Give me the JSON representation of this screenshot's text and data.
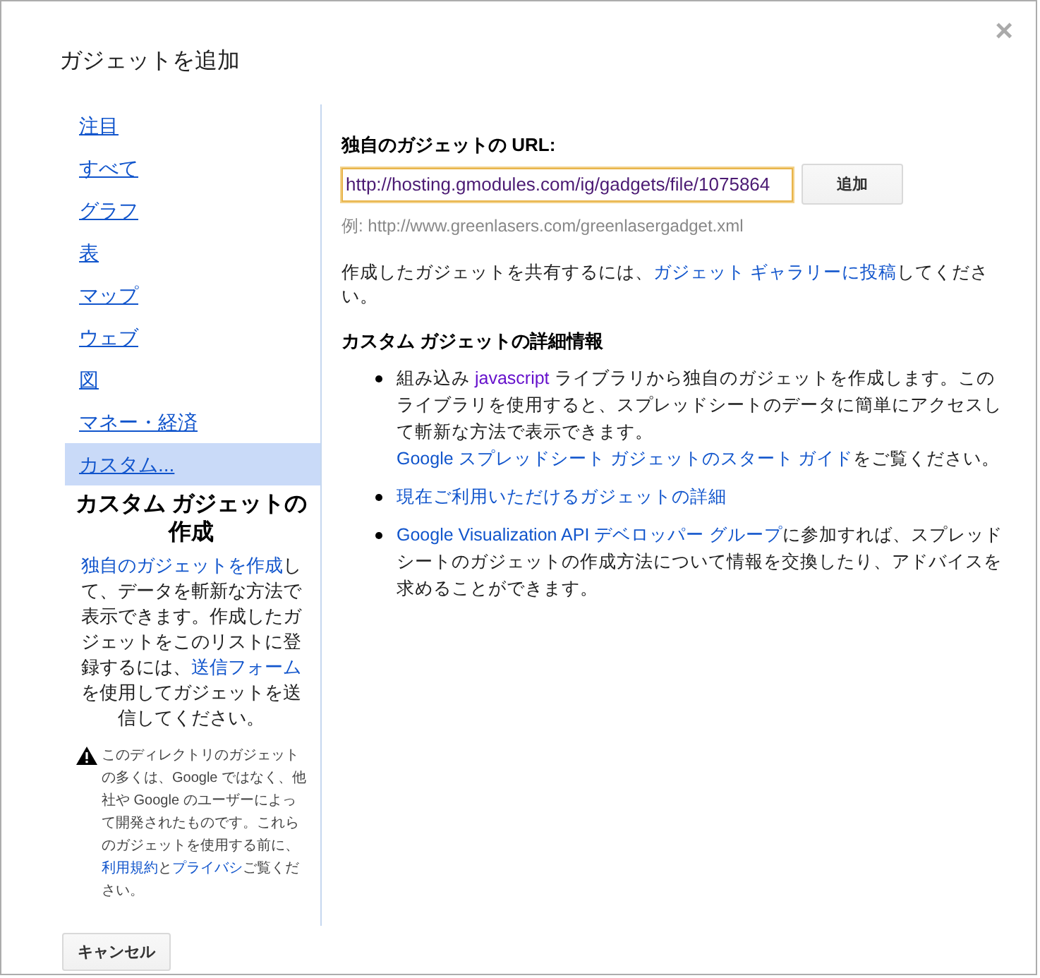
{
  "dialog": {
    "title": "ガジェットを追加",
    "close": "×"
  },
  "sidebar": {
    "items": [
      {
        "label": "注目",
        "selected": false
      },
      {
        "label": "すべて",
        "selected": false
      },
      {
        "label": "グラフ",
        "selected": false
      },
      {
        "label": "表",
        "selected": false
      },
      {
        "label": "マップ",
        "selected": false
      },
      {
        "label": "ウェブ",
        "selected": false
      },
      {
        "label": "図",
        "selected": false
      },
      {
        "label": "マネー・経済",
        "selected": false
      },
      {
        "label": "カスタム...",
        "selected": true
      }
    ],
    "custom_info": {
      "heading": "カスタム ガジェットの作成",
      "description": [
        {
          "kind": "link",
          "text": "独自のガジェットを作成"
        },
        {
          "kind": "text",
          "text": "して、データを斬新な方法で表示できます。作成したガジェットをこのリストに登録するには、"
        },
        {
          "kind": "link",
          "text": "送信フォーム"
        },
        {
          "kind": "text",
          "text": "を使用してガジェットを送信してください。"
        }
      ],
      "warning": [
        {
          "kind": "text",
          "text": "このディレクトリのガジェットの多くは、Google ではなく、他社や Google のユーザーによって開発されたものです。これらのガジェットを使用する前に、"
        },
        {
          "kind": "link",
          "text": "利用規約"
        },
        {
          "kind": "text",
          "text": "と"
        },
        {
          "kind": "link",
          "text": "プライバシ"
        },
        {
          "kind": "text",
          "text": "ご覧ください。"
        }
      ]
    }
  },
  "url_section": {
    "label": "独自のガジェットの URL:",
    "value": "http://hosting.gmodules.com/ig/gadgets/file/1075864",
    "add_button": "追加",
    "example": "例: http://www.greenlasers.com/greenlasergadget.xml"
  },
  "share_note": [
    {
      "kind": "text",
      "text": "作成したガジェットを共有するには、"
    },
    {
      "kind": "link",
      "text": "ガジェット ギャラリーに投稿"
    },
    {
      "kind": "text",
      "text": "してください。"
    }
  ],
  "details": {
    "heading": "カスタム ガジェットの詳細情報",
    "bullets": [
      [
        {
          "kind": "text",
          "text": "組み込み "
        },
        {
          "kind": "visited-link",
          "text": "javascript"
        },
        {
          "kind": "text",
          "text": " ライブラリから独自のガジェットを作成します。このライブラリを使用すると、スプレッドシートのデータに簡単にアクセスして斬新な方法で表示できます。"
        },
        {
          "kind": "link",
          "text": "Google スプレッドシート ガジェットのスタート ガイド"
        },
        {
          "kind": "text",
          "text": "をご覧ください。"
        }
      ],
      [
        {
          "kind": "link",
          "text": "現在ご利用いただけるガジェットの詳細"
        }
      ],
      [
        {
          "kind": "link",
          "text": "Google Visualization API デベロッパー グループ"
        },
        {
          "kind": "text",
          "text": "に参加すれば、スプレッドシートのガジェットの作成方法について情報を交換したり、アドバイスを求めることができます。"
        }
      ]
    ]
  },
  "cancel_button": "キャンセル"
}
